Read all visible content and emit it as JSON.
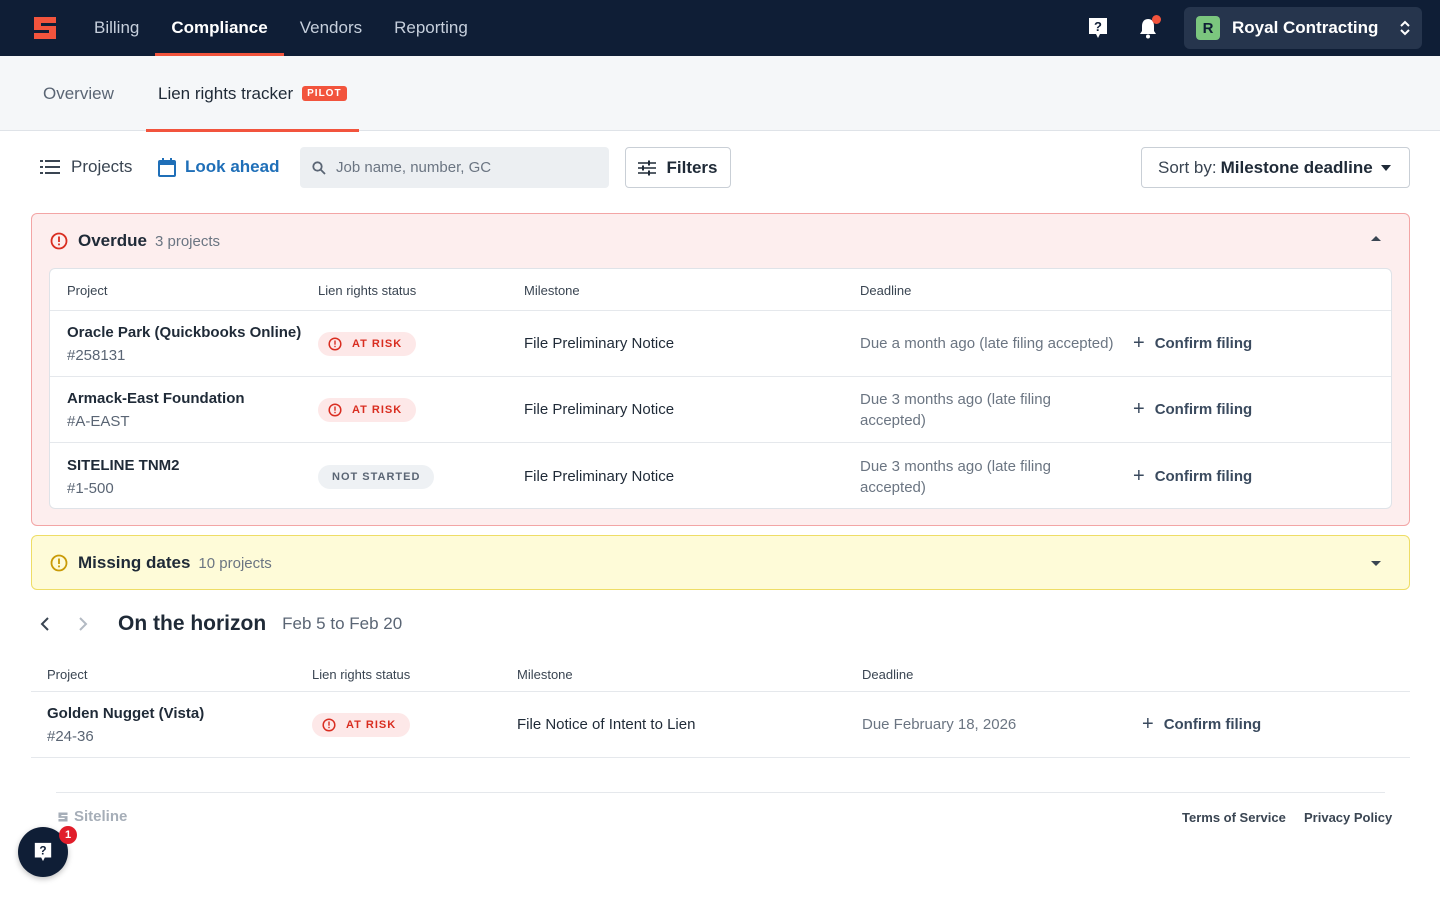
{
  "nav": {
    "items": [
      {
        "label": "Billing",
        "active": false
      },
      {
        "label": "Compliance",
        "active": true
      },
      {
        "label": "Vendors",
        "active": false
      },
      {
        "label": "Reporting",
        "active": false
      }
    ],
    "company": {
      "initial": "R",
      "name": "Royal Contracting"
    }
  },
  "subtabs": {
    "overview": "Overview",
    "tracker": "Lien rights tracker",
    "pilot": "PILOT"
  },
  "toolbar": {
    "projects": "Projects",
    "look_ahead": "Look ahead",
    "search_placeholder": "Job name, number, GC",
    "filters": "Filters",
    "sort_prefix": "Sort by:",
    "sort_value": "Milestone deadline"
  },
  "columns": {
    "project": "Project",
    "status": "Lien rights status",
    "milestone": "Milestone",
    "deadline": "Deadline"
  },
  "overdue": {
    "title": "Overdue",
    "count": "3 projects",
    "rows": [
      {
        "name": "Oracle Park (Quickbooks Online)",
        "number": "#258131",
        "status": "AT RISK",
        "milestone": "File Preliminary Notice",
        "deadline": "Due a month ago (late filing accepted)",
        "action": "Confirm filing"
      },
      {
        "name": "Armack-East Foundation",
        "number": "#A-EAST",
        "status": "AT RISK",
        "milestone": "File Preliminary Notice",
        "deadline": "Due 3 months ago (late filing accepted)",
        "action": "Confirm filing"
      },
      {
        "name": "SITELINE TNM2",
        "number": "#1-500",
        "status": "NOT STARTED",
        "milestone": "File Preliminary Notice",
        "deadline": "Due 3 months ago (late filing accepted)",
        "action": "Confirm filing"
      }
    ]
  },
  "missing": {
    "title": "Missing dates",
    "count": "10 projects"
  },
  "horizon": {
    "title": "On the horizon",
    "range": "Feb 5 to Feb 20",
    "rows": [
      {
        "name": "Golden Nugget (Vista)",
        "number": "#24-36",
        "status": "AT RISK",
        "milestone": "File Notice of Intent to Lien",
        "deadline": "Due February 18, 2026",
        "action": "Confirm filing"
      }
    ]
  },
  "footer": {
    "brand": "Siteline",
    "terms": "Terms of Service",
    "privacy": "Privacy Policy"
  },
  "help": {
    "badge_count": "1"
  },
  "colors": {
    "navy": "#0f1e36",
    "accent": "#f2543d",
    "overdue_bg": "#fdeeee",
    "missing_bg": "#fefbd8",
    "link_blue": "#1f6fb8"
  }
}
